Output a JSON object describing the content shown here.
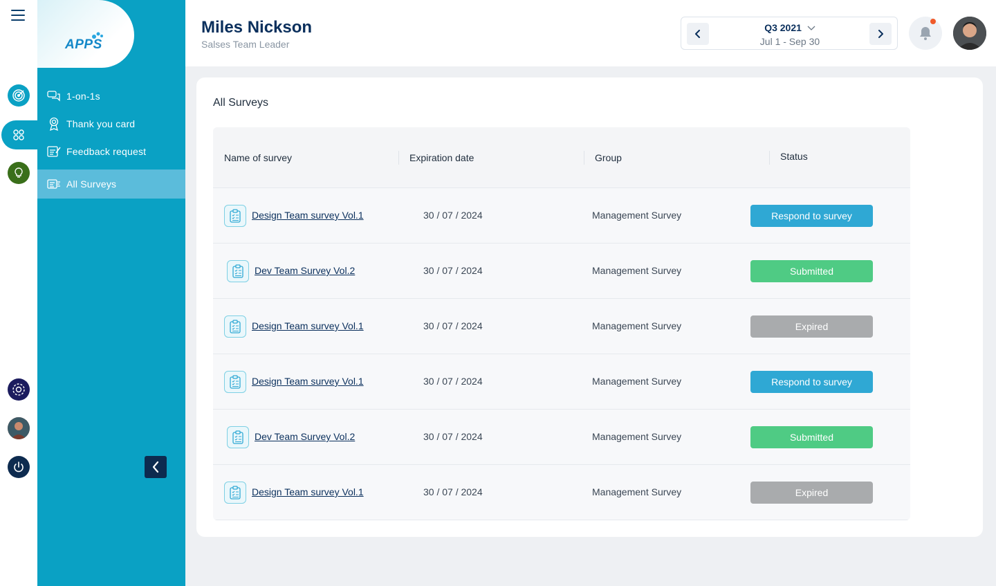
{
  "brand": {
    "logo_text": "APPS"
  },
  "rail": {
    "items": [
      {
        "name": "goals-icon"
      },
      {
        "name": "people-icon"
      },
      {
        "name": "ideas-icon"
      },
      {
        "name": "settings-icon"
      },
      {
        "name": "avatar"
      },
      {
        "name": "power-icon"
      }
    ]
  },
  "sidebar": {
    "items": [
      {
        "label": "1-on-1s",
        "icon": "chat-icon"
      },
      {
        "label": "Thank you card",
        "icon": "award-icon"
      },
      {
        "label": "Feedback request",
        "icon": "feedback-icon"
      },
      {
        "label": "All Surveys",
        "icon": "surveys-icon",
        "active": true
      }
    ]
  },
  "header": {
    "name": "Miles Nickson",
    "role": "Salses Team Leader",
    "period": {
      "title": "Q3 2021",
      "range": "Jul 1 - Sep 30"
    }
  },
  "main": {
    "title": "All Surveys",
    "columns": [
      "Name of survey",
      "Expiration date",
      "Group",
      "Status"
    ],
    "rows": [
      {
        "name": "Design Team survey Vol.1",
        "date": "30 / 07 / 2024",
        "group": "Management Survey",
        "status": "Respond to survey",
        "status_type": "respond"
      },
      {
        "name": "Dev Team Survey Vol.2",
        "date": "30 / 07 / 2024",
        "group": "Management Survey",
        "status": "Submitted",
        "status_type": "submitted"
      },
      {
        "name": "Design Team survey Vol.1",
        "date": "30 / 07 / 2024",
        "group": "Management Survey",
        "status": "Expired",
        "status_type": "expired"
      },
      {
        "name": "Design Team survey Vol.1",
        "date": "30 / 07 / 2024",
        "group": "Management Survey",
        "status": "Respond to survey",
        "status_type": "respond"
      },
      {
        "name": "Dev Team Survey Vol.2",
        "date": "30 / 07 / 2024",
        "group": "Management Survey",
        "status": "Submitted",
        "status_type": "submitted"
      },
      {
        "name": "Design Team survey Vol.1",
        "date": "30 / 07 / 2024",
        "group": "Management Survey",
        "status": "Expired",
        "status_type": "expired"
      }
    ]
  },
  "colors": {
    "sidebar": "#0aa1c4",
    "respond": "#2fa8d4",
    "submitted": "#4fcb84",
    "expired": "#a9abad",
    "navy": "#0a2f5c"
  }
}
